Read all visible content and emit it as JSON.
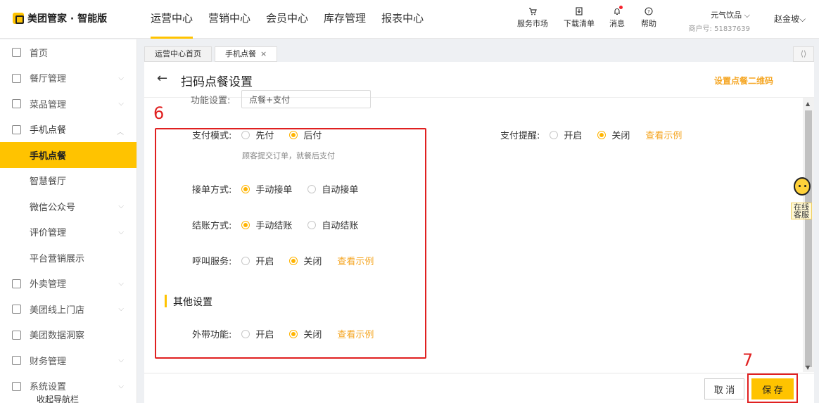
{
  "header": {
    "logo": "美团管家 · 智能版",
    "nav": [
      "运营中心",
      "营销中心",
      "会员中心",
      "库存管理",
      "报表中心"
    ],
    "tools": {
      "market": "服务市场",
      "download": "下载清单",
      "messages": "消息",
      "help": "帮助"
    },
    "store_name": "元气饮品",
    "store_id": "商户号: 51837639",
    "user": "赵金坡"
  },
  "sidebar": {
    "items": {
      "home": "首页",
      "restaurant": "餐厅管理",
      "dishes": "菜品管理",
      "mobile": "手机点餐",
      "mobile_sub": "手机点餐",
      "smart": "智慧餐厅",
      "wechat": "微信公众号",
      "review": "评价管理",
      "platform": "平台营销展示",
      "takeout": "外卖管理",
      "online_store": "美团线上门店",
      "data": "美团数据洞察",
      "finance": "财务管理",
      "system": "系统设置"
    },
    "collapse": "收起导航栏"
  },
  "tabs": {
    "home": "运营中心首页",
    "current": "手机点餐",
    "close": "×"
  },
  "page": {
    "title": "扫码点餐设置",
    "qr_link": "设置点餐二维码",
    "partial_label": "功能设置:",
    "partial_value": "点餐+支付"
  },
  "form": {
    "payment": {
      "label": "支付模式:",
      "options": [
        "先付",
        "后付"
      ],
      "selected": 1,
      "hint": "顾客提交订单，就餐后支付"
    },
    "pay_reminder": {
      "label": "支付提醒:",
      "options": [
        "开启",
        "关闭"
      ],
      "selected": 1,
      "example": "查看示例"
    },
    "accept": {
      "label": "接单方式:",
      "options": [
        "手动接单",
        "自动接单"
      ],
      "selected": 0
    },
    "checkout": {
      "label": "结账方式:",
      "options": [
        "手动结账",
        "自动结账"
      ],
      "selected": 0
    },
    "call": {
      "label": "呼叫服务:",
      "options": [
        "开启",
        "关闭"
      ],
      "selected": 1,
      "example": "查看示例"
    },
    "other_section": "其他设置",
    "takeaway": {
      "label": "外带功能:",
      "options": [
        "开启",
        "关闭"
      ],
      "selected": 1,
      "example": "查看示例"
    }
  },
  "footer": {
    "cancel": "取 消",
    "save": "保 存"
  },
  "annotations": {
    "box_number": "6",
    "save_number": "7"
  },
  "support": {
    "label": "在线客服"
  },
  "colors": {
    "accent": "#ffc300",
    "link": "#f5a623",
    "annotation": "#e02020"
  }
}
